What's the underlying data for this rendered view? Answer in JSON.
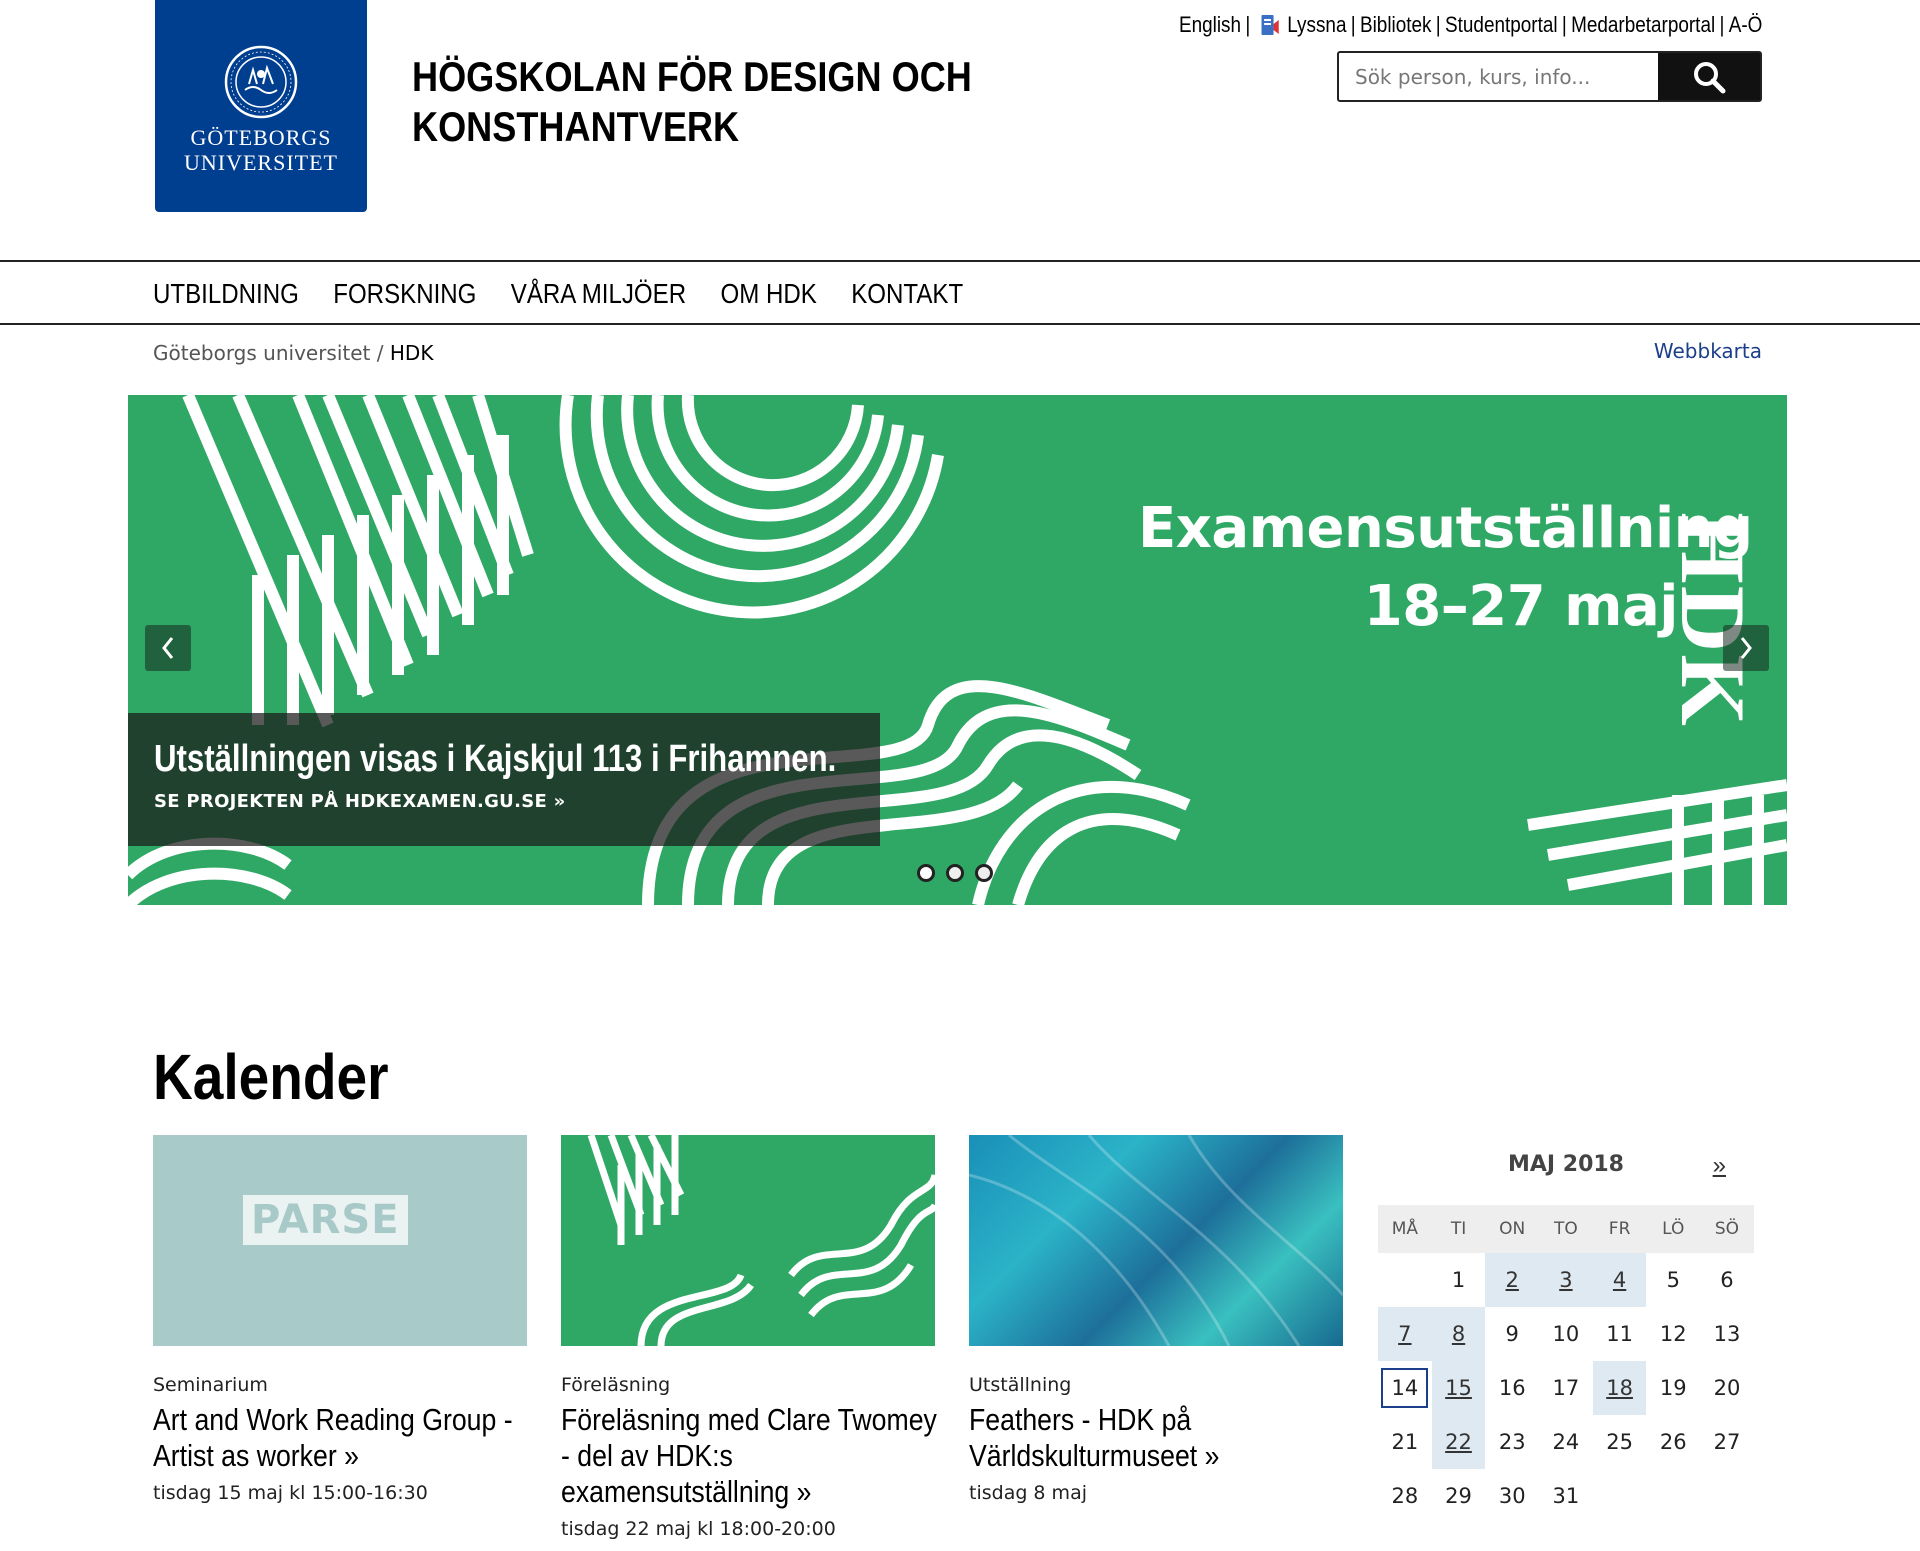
{
  "header": {
    "logo_text_line1": "GÖTEBORGS",
    "logo_text_line2": "UNIVERSITET",
    "site_title_line1": "HÖGSKOLAN FÖR DESIGN OCH",
    "site_title_line2": "KONSTHANTVERK",
    "top_links": {
      "english": "English",
      "listen": "Lyssna",
      "library": "Bibliotek",
      "student_portal": "Studentportal",
      "staff_portal": "Medarbetarportal",
      "a_to_z": "A-Ö",
      "separator": "|"
    },
    "search": {
      "placeholder": "Sök person, kurs, info...",
      "value": ""
    },
    "icons": [
      "university-seal-icon",
      "listen-icon",
      "search-icon"
    ]
  },
  "nav": {
    "items": [
      "UTBILDNING",
      "FORSKNING",
      "VÅRA MILJÖER",
      "OM HDK",
      "KONTAKT"
    ]
  },
  "breadcrumb": {
    "root": "Göteborgs universitet",
    "separator": "/",
    "current": "HDK",
    "sitemap": "Webbkarta"
  },
  "hero": {
    "headline_line1": "Examensutställning",
    "headline_line2": "18–27 maj",
    "vertical_text": "HDK",
    "caption_title": "Utställningen visas i Kajskjul 113 i Frihamnen.",
    "caption_link": "SE PROJEKTEN PÅ HDKEXAMEN.GU.SE »",
    "slides": 3,
    "active_slide": 1,
    "colors": {
      "background": "#2fa865",
      "shapes": "#ffffff"
    }
  },
  "calendar_section": {
    "heading": "Kalender",
    "cards": [
      {
        "category": "Seminarium",
        "title": "Art and Work Reading Group - Artist as worker",
        "arrow": "»",
        "date": "tisdag 15 maj kl 15:00-16:30",
        "image_label": "PARSE"
      },
      {
        "category": "Föreläsning",
        "title": "Föreläsning med Clare Twomey - del av HDK:s examensutställning",
        "arrow": "»",
        "date": "tisdag 22 maj kl 18:00-20:00"
      },
      {
        "category": "Utställning",
        "title": "Feathers - HDK på Världskulturmuseet",
        "arrow": "»",
        "date": "tisdag 8 maj"
      }
    ],
    "mini_calendar": {
      "month": "MAJ 2018",
      "next": "»",
      "weekdays": [
        "MÅ",
        "TI",
        "ON",
        "TO",
        "FR",
        "LÖ",
        "SÖ"
      ],
      "first_weekday_offset": 1,
      "days_in_month": 31,
      "event_days": [
        2,
        3,
        4,
        7,
        8,
        15,
        18,
        22
      ],
      "today": 14
    }
  }
}
